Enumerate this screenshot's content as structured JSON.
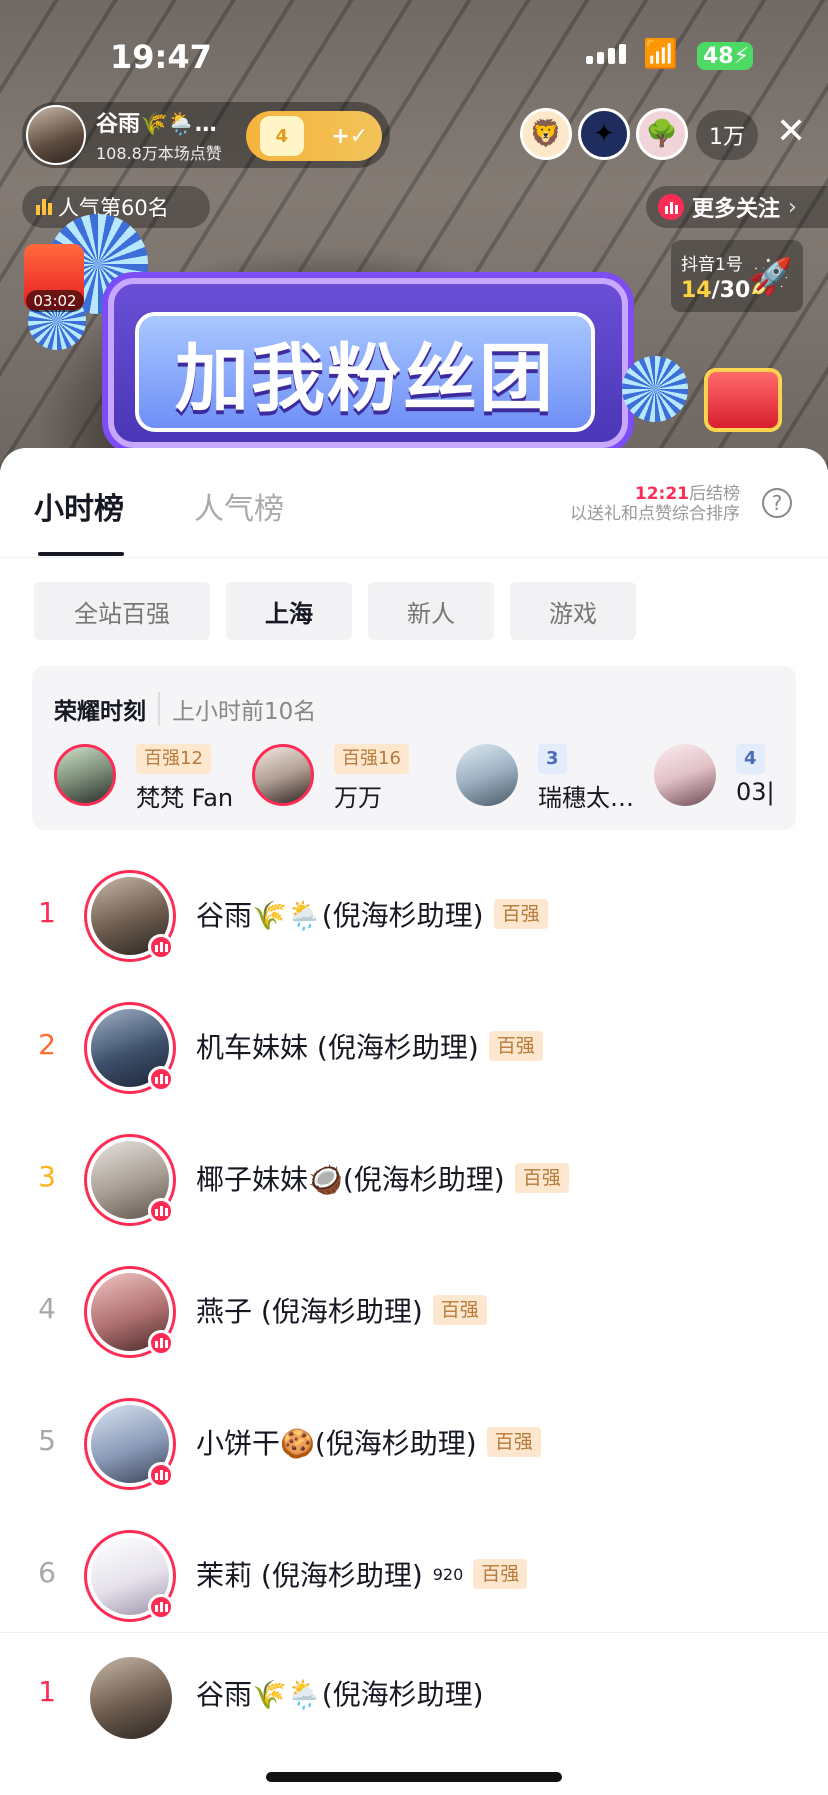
{
  "status_bar": {
    "time": "19:47",
    "battery": "48"
  },
  "live_header": {
    "anchor_name": "谷雨🌾🌦️…",
    "anchor_likes": "108.8万本场点赞",
    "fan_level": "4",
    "fan_plus": "+",
    "viewer_count": "1万",
    "popularity_rank": "人气第60名",
    "more_follow": "更多关注",
    "red_packet_timer": "03:02",
    "rank_card_title": "抖音1号",
    "rank_card_current": "14",
    "rank_card_total": "/30",
    "banner_text": "加我粉丝团"
  },
  "sheet": {
    "tabs": [
      {
        "label": "小时榜"
      },
      {
        "label": "人气榜"
      }
    ],
    "settle_time": "12:21",
    "settle_suffix": "后结榜",
    "settle_note": "以送礼和点赞综合排序",
    "help_symbol": "?",
    "filters": [
      {
        "label": "全站百强"
      },
      {
        "label": "上海"
      },
      {
        "label": "新人"
      },
      {
        "label": "游戏"
      }
    ],
    "selected_filter": "上海",
    "honor": {
      "title": "荣耀时刻",
      "subtitle": "上小时前10名",
      "items": [
        {
          "tag": "百强12",
          "name": "梵梵 Fan"
        },
        {
          "tag": "百强16",
          "name": "万万"
        },
        {
          "tag": "3",
          "name": "瑞穗太…"
        },
        {
          "tag": "4",
          "name": "03|"
        }
      ]
    },
    "ranking": [
      {
        "rank": "1",
        "name": "谷雨🌾🌦️(倪海杉助理)",
        "tag": "百强"
      },
      {
        "rank": "2",
        "name": "机车妹妹 (倪海杉助理)",
        "tag": "百强"
      },
      {
        "rank": "3",
        "name": "椰子妹妹🥥(倪海杉助理)",
        "tag": "百强"
      },
      {
        "rank": "4",
        "name": "燕子 (倪海杉助理)",
        "tag": "百强"
      },
      {
        "rank": "5",
        "name": "小饼干🍪(倪海杉助理)",
        "tag": "百强"
      },
      {
        "rank": "6",
        "name": "茉莉 (倪海杉助理)",
        "name_sup": "920",
        "tag": "百强"
      }
    ],
    "current_anchor": {
      "rank": "1",
      "name": "谷雨🌾🌦️(倪海杉助理)"
    }
  }
}
